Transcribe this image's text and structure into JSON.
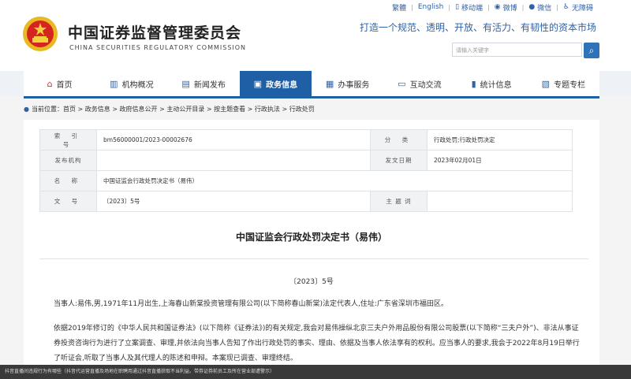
{
  "topbar": {
    "trad": "繁體",
    "english": "English",
    "mobile": "移动端",
    "weibo": "微博",
    "wechat": "微信",
    "accessible": "无障碍"
  },
  "header": {
    "title_cn": "中国证券监督管理委员会",
    "title_en": "CHINA SECURITIES REGULATORY COMMISSION",
    "slogan": "打造一个规范、透明、开放、有活力、有韧性的资本市场",
    "search_placeholder": "请输入关键字"
  },
  "nav": {
    "items": [
      {
        "label": "首页",
        "icon": "home-icon"
      },
      {
        "label": "机构概况",
        "icon": "building-icon"
      },
      {
        "label": "新闻发布",
        "icon": "news-icon"
      },
      {
        "label": "政务信息",
        "icon": "gov-info-icon"
      },
      {
        "label": "办事服务",
        "icon": "service-icon"
      },
      {
        "label": "互动交流",
        "icon": "chat-icon"
      },
      {
        "label": "统计信息",
        "icon": "stats-icon"
      },
      {
        "label": "专题专栏",
        "icon": "topic-icon"
      }
    ],
    "active_index": 3,
    "active_color": "#1f5fa5"
  },
  "breadcrumb": "当前位置：首页 > 政务信息 > 政府信息公开 > 主动公开目录 > 按主题查看 > 行政执法 > 行政处罚",
  "meta": {
    "index_label": "索 引 号",
    "index_value": "bm56000001/2023-00002676",
    "category_label": "分 类",
    "category_value": "行政处罚;行政处罚决定",
    "publisher_label": "发布机构",
    "publisher_value": "",
    "date_label": "发文日期",
    "date_value": "2023年02月01日",
    "name_label": "名 称",
    "name_value": "中国证监会行政处罚决定书（易伟）",
    "docno_label": "文 号",
    "docno_value": "〔2023〕5号",
    "subject_label": "主 题 词",
    "subject_value": ""
  },
  "document": {
    "title": "中国证监会行政处罚决定书（易伟）",
    "number": "〔2023〕5号",
    "para1": "当事人:易伟,男,1971年11月出生,上海春山新棠投资管理有限公司(以下简称春山新棠)法定代表人,住址:广东省深圳市福田区。",
    "para2": "依据2019年修订的《中华人民共和国证券法》(以下简称《证券法》)的有关规定,我会对易伟操纵北京三夫户外用品股份有限公司股票(以下简称“三夫户外”)、非法从事证券投资咨询行为进行了立案调查、审理,并依法向当事人告知了作出行政处罚的事实、理由、依据及当事人依法享有的权利。应当事人的要求,我会于2022年8月19日举行了听证会,听取了当事人及其代理人的陈述和申辩。本案现已调查、审理终结。"
  },
  "ticker": "抖音直播间违规行为有哪些（抖音代运营直播及场地在职聘用通过抖音直播获取不当利益。带券证券前员工及所在营业部遭警示）"
}
